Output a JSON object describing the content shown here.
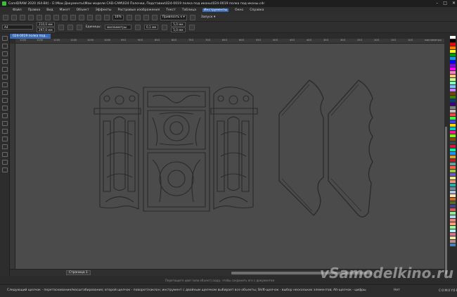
{
  "window": {
    "title": "CorelDRAW 2020 (64-Bit) - E:\\Мои Документы\\Мои модели CAD-CAM\\024 Полочки, Подставки\\024-0019 полка под иконы\\024-0019 полка под иконы.cdr",
    "minimize": "–",
    "maximize": "□",
    "close": "✕"
  },
  "menu": [
    "Файл",
    "Правка",
    "Вид",
    "Макет",
    "Объект",
    "Эффекты",
    "Растровые изображения",
    "Текст",
    "Таблица",
    "Инструменты",
    "Окно",
    "Справка"
  ],
  "menu_active": "Инструменты",
  "toolbar": {
    "zoom": "16%",
    "snap": "Привязать к ▾",
    "launch": "Запуск ▾"
  },
  "propbar": {
    "page_size": "A4",
    "width": "210,0 мм",
    "height": "297,0 мм",
    "units_label": "Единицы:",
    "units": "миллиметры",
    "nudge": "0,1 мм",
    "dup_x": "5,0 мм",
    "dup_y": "5,0 мм"
  },
  "document_tab": "024-0019 полка под...",
  "ruler_marks": [
    "1250",
    "1200",
    "1150",
    "1100",
    "1050",
    "1000",
    "950",
    "900",
    "850",
    "800",
    "750",
    "700",
    "650",
    "600",
    "550",
    "500",
    "450",
    "400",
    "350",
    "300",
    "250",
    "200",
    "150",
    "100"
  ],
  "ruler_unit": "миллиметры",
  "page_tab": "Страница 1",
  "hint": "Перетащите цвет (или объект) сюда, чтобы сохранить его с документом",
  "status": {
    "text": "Следующий щелчок - перетаскивание/масштабирование; второй щелчок - поворот/наклон; инструмент с двойным щелчком выбирает все объекты; Shift-щелчок - выбор нескольких элементов; Alt-щелчок - цифры",
    "fill": "Нет",
    "color": "C:0 M:0 Y:0 K:100  0,100 мм"
  },
  "watermark": "vSamodelkino.ru",
  "colors": {
    "accent": "#3b6ab7",
    "canvas": "#4b4b4b",
    "outline": "#2c2c2c"
  },
  "palette": [
    "#ffffff",
    "#000000",
    "#ff0000",
    "#ff8000",
    "#ffff00",
    "#00a000",
    "#00a0ff",
    "#0000ff",
    "#8000ff",
    "#ff00ff",
    "#ff80c0",
    "#ffc080",
    "#c0ff80",
    "#80ffc0",
    "#80c0ff",
    "#c080ff",
    "#804000",
    "#408000",
    "#004080",
    "#400080",
    "#808080",
    "#c0c0c0",
    "#ff4040",
    "#40ff40",
    "#4040ff",
    "#ffd700",
    "#00ced1",
    "#ff1493",
    "#7fff00",
    "#8b4513",
    "#2f4f4f",
    "#dc143c",
    "#00fa9a",
    "#1e90ff",
    "#daa520",
    "#b22222",
    "#5f9ea0",
    "#ff6347",
    "#9acd32",
    "#6a5acd",
    "#f0e68c",
    "#e9967a",
    "#20b2aa",
    "#778899",
    "#b0c4de",
    "#ffe4b5",
    "#d2691e",
    "#556b2f",
    "#483d8b",
    "#cd5c5c",
    "#90ee90",
    "#add8e6",
    "#f08080",
    "#ffa07a",
    "#98fb98",
    "#afeeee",
    "#db7093",
    "#eee8aa",
    "#bc8f8f",
    "#4682b4"
  ]
}
